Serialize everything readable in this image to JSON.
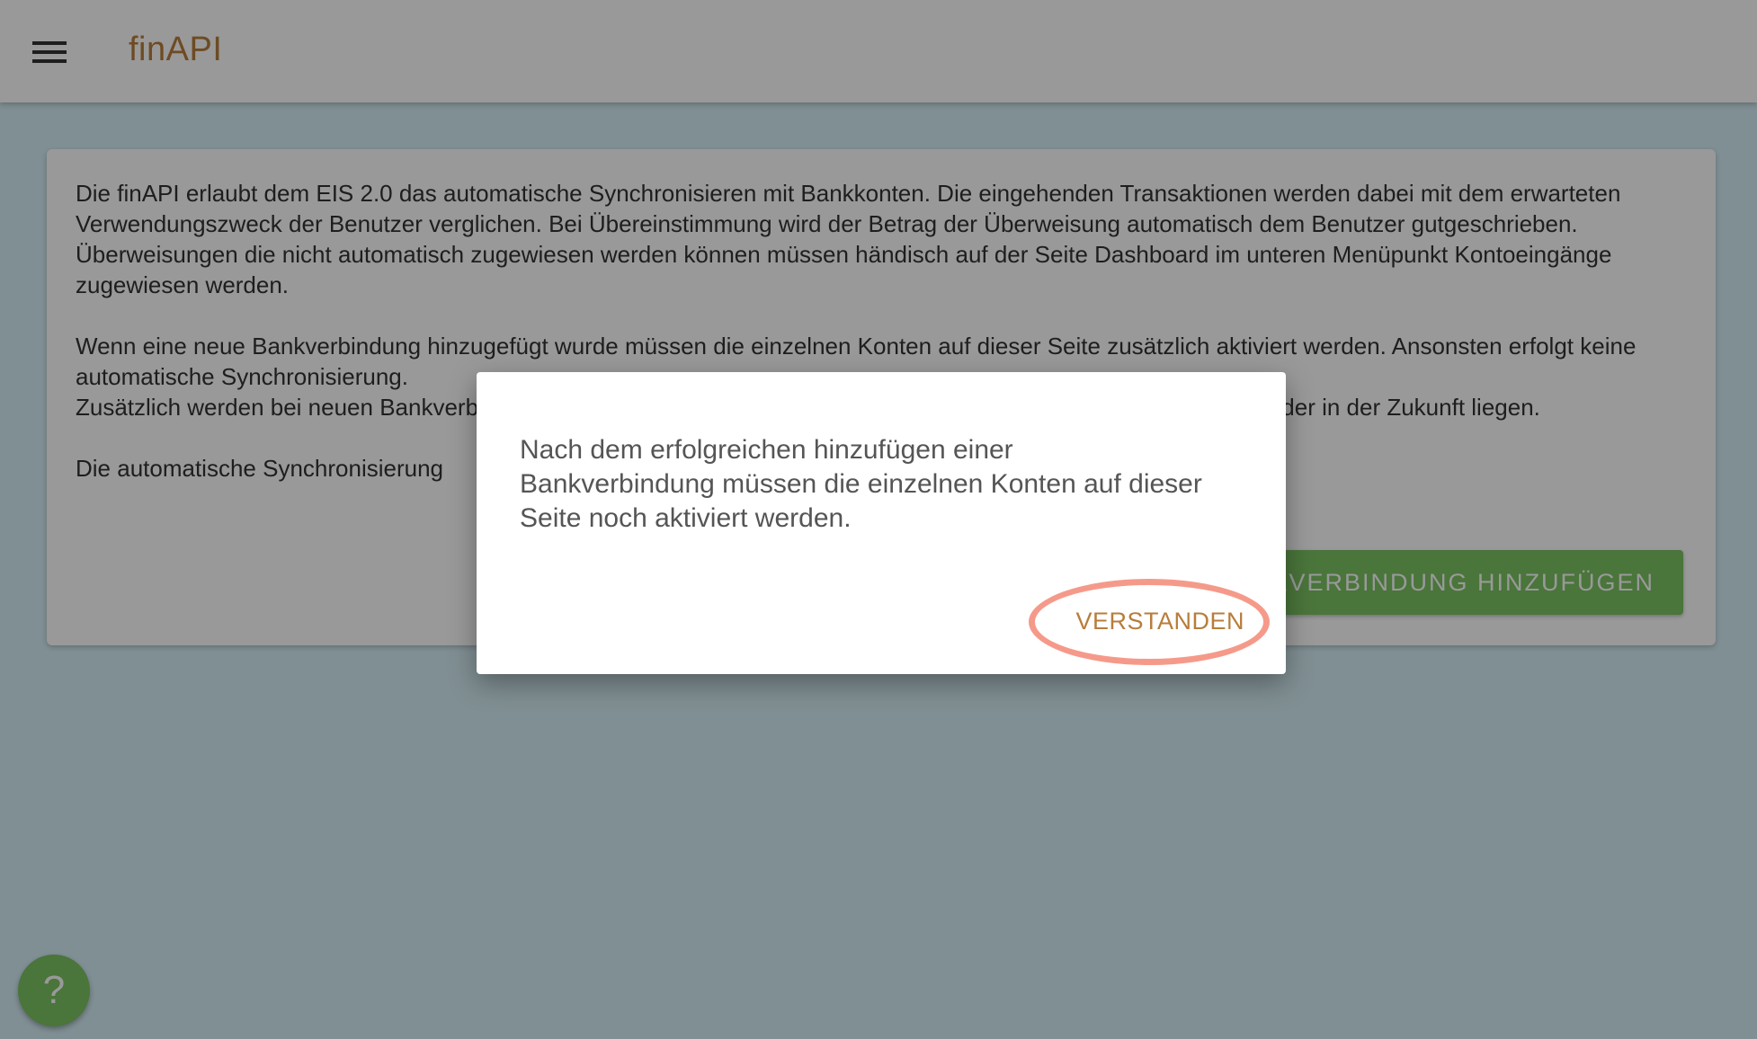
{
  "app_bar": {
    "brand": "finAPI",
    "menu_icon": "hamburger-menu-icon"
  },
  "info_card": {
    "paragraphs": [
      "Die finAPI erlaubt dem EIS 2.0 das automatische Synchronisieren mit Bankkonten. Die eingehenden Transaktionen werden dabei mit dem erwarteten Verwendungszweck der Benutzer verglichen. Bei Übereinstimmung wird der Betrag der Überweisung automatisch dem Benutzer gutgeschrieben. Überweisungen die nicht automatisch zugewiesen werden können müssen händisch auf der Seite Dashboard im unteren Menüpunkt Kontoeingänge zugewiesen werden.",
      "Wenn eine neue Bankverbindung hinzugefügt wurde müssen die einzelnen Konten auf dieser Seite zusätzlich aktiviert werden. Ansonsten erfolgt keine automatische Synchronisierung.",
      "Zusätzlich werden bei neuen Bankverbindungen nur Transaktionen synchronisiert, deren Buchungsdatum heute ist oder in der Zukunft liegen.",
      "Die automatische Synchronisierung"
    ],
    "add_button_label": "BANKVERBINDUNG HINZUFÜGEN"
  },
  "dialog": {
    "message": "Nach dem erfolgreichen hinzufügen einer Bankverbindung müssen die einzelnen Konten auf dieser Seite noch aktiviert werden.",
    "action_label": "VERSTANDEN"
  },
  "help_button": {
    "label": "?",
    "icon": "help-icon"
  },
  "colors": {
    "brand": "#b87d3b",
    "primary_button": "#7cc363",
    "highlight_ring": "#f59a8a",
    "background": "#d5eef6"
  }
}
